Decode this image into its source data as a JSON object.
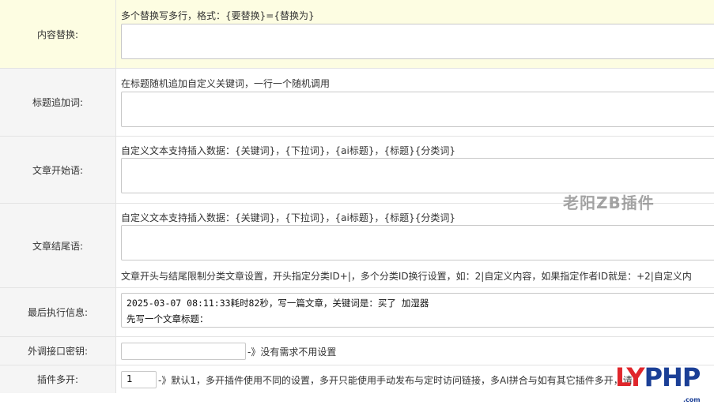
{
  "rows": {
    "replace": {
      "label": "内容替换:",
      "hint": "多个替换写多行，格式：{要替换}={替换为}",
      "value": ""
    },
    "title_append": {
      "label": "标题追加词:",
      "hint": "在标题随机追加自定义关键词，一行一个随机调用",
      "value": ""
    },
    "article_start": {
      "label": "文章开始语:",
      "hint": "自定义文本支持插入数据：{关键词}，{下拉词}，{ai标题}，{标题}{分类词}",
      "value": ""
    },
    "article_end": {
      "label": "文章结尾语:",
      "hint": "自定义文本支持插入数据：{关键词}，{下拉词}，{ai标题}，{标题}{分类词}",
      "value": "",
      "note": "文章开头与结尾限制分类文章设置，开头指定分类ID+|，多个分类ID换行设置，如：2|自定义内容，如果指定作者ID就是：+2|自定义内"
    },
    "last_exec": {
      "label": "最后执行信息:",
      "line1": "2025-03-07 08:11:33耗时82秒，写一篇文章，关键词是：买了 加湿器",
      "line2": "先写一个文章标题："
    },
    "api_key": {
      "label": "外调接口密钥:",
      "value": "",
      "after": "-》没有需求不用设置"
    },
    "multi_open": {
      "label": "插件多开:",
      "value": "1",
      "after": "-》默认1，多开插件使用不同的设置，多开只能使用手动发布与定时访问链接，多AI拼合与如有其它插件多开，请"
    }
  },
  "watermarks": {
    "center": "老阳ZB插件",
    "logo_ly": "LY",
    "logo_php": "PHP",
    "logo_sub": ".com"
  }
}
